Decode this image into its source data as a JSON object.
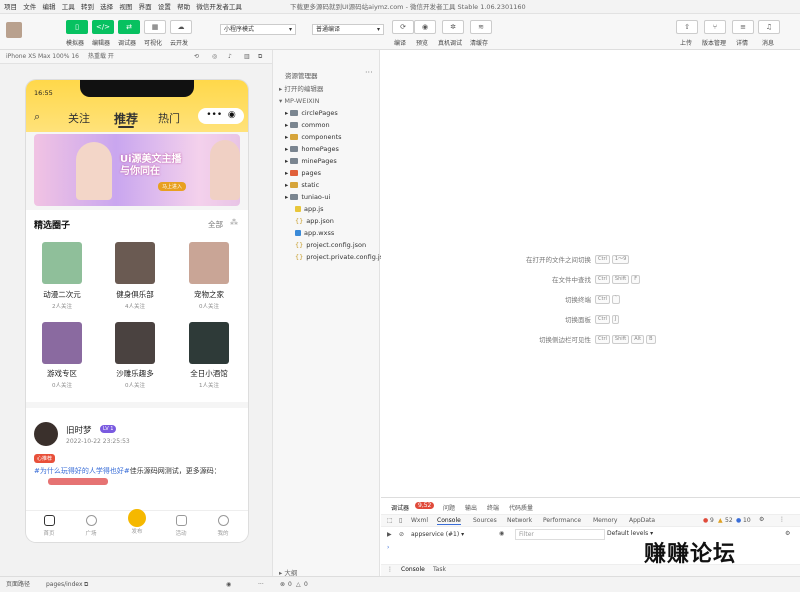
{
  "menu": {
    "items": [
      "项目",
      "文件",
      "编辑",
      "工具",
      "转到",
      "选择",
      "视图",
      "界面",
      "设置",
      "帮助",
      "微信开发者工具"
    ],
    "center_title": "下载更多源码就到UI源码站aiymz.com - 微信开发者工具 Stable 1.06.2301160"
  },
  "toolbar": {
    "buttons": [
      "模拟器",
      "编辑器",
      "调试器",
      "可视化",
      "云开发"
    ],
    "mode_select": "小程序模式",
    "compile_select": "普通编译",
    "actions": [
      "编译",
      "预览",
      "真机调试",
      "清缓存"
    ],
    "right_actions": [
      "上传",
      "版本管理",
      "详情",
      "消息"
    ]
  },
  "simulator": {
    "device": "iPhone XS Max 100% 16",
    "hot_reload": "热重载 开",
    "time": "16:55",
    "tabs": [
      "关注",
      "推荐",
      "热门"
    ],
    "banner_text": "Ui源美文主播 与你同在",
    "banner_btn": "马上进入",
    "circle_title": "精选圈子",
    "circle_all": "全部",
    "circles": [
      {
        "name": "动漫二次元",
        "count": "2人关注",
        "color": "#8fbf9a"
      },
      {
        "name": "健身俱乐部",
        "count": "4人关注",
        "color": "#6a5a52"
      },
      {
        "name": "宠物之家",
        "count": "0人关注",
        "color": "#c9a596"
      },
      {
        "name": "游戏专区",
        "count": "0人关注",
        "color": "#8a6aa0"
      },
      {
        "name": "沙雕乐趣多",
        "count": "0人关注",
        "color": "#4a4240"
      },
      {
        "name": "全日小酒馆",
        "count": "1人关注",
        "color": "#2e3a38"
      }
    ],
    "post": {
      "author": "旧时梦",
      "level": "LV 1",
      "time": "2022-10-22 23:25:53",
      "tag": "心推荐",
      "topic": "#为什么玩得好的人学得也好#",
      "content": "佳乐源码网测试，更多源码："
    },
    "tabbar": [
      "首页",
      "广场",
      "发布",
      "活动",
      "我的"
    ]
  },
  "explorer": {
    "title": "资源管理器",
    "opened": "打开的编辑器",
    "project": "MP-WEIXIN",
    "folders": [
      "circlePages",
      "common",
      "components",
      "homePages",
      "minePages",
      "pages",
      "static",
      "tuniao-ui"
    ],
    "files": [
      "app.js",
      "app.json",
      "app.wxss",
      "project.config.json",
      "project.private.config.js..."
    ]
  },
  "hints": [
    {
      "label": "在打开的文件之间切换",
      "keys": [
        "Ctrl",
        "1～9"
      ]
    },
    {
      "label": "在文件中查找",
      "keys": [
        "Ctrl",
        "Shift",
        "F"
      ]
    },
    {
      "label": "切换终端",
      "keys": [
        "Ctrl",
        "`"
      ]
    },
    {
      "label": "切换面板",
      "keys": [
        "Ctrl",
        "J"
      ]
    },
    {
      "label": "切换侧边栏可见性",
      "keys": [
        "Ctrl",
        "Shift",
        "Alt",
        "B"
      ]
    }
  ],
  "devtools": {
    "label": "调试器",
    "badge": "9,52",
    "top_tabs": [
      "问题",
      "输出",
      "终端",
      "代码质量"
    ],
    "tabs": [
      "Wxml",
      "Console",
      "Sources",
      "Network",
      "Performance",
      "Memory",
      "AppData"
    ],
    "counts": {
      "errors": "9",
      "warnings": "52",
      "info": "10"
    },
    "context": "appservice (#1)",
    "filter_placeholder": "Filter",
    "levels": "Default levels",
    "bottom_tabs": [
      "Console",
      "Task"
    ]
  },
  "status": {
    "path_label": "页面路径",
    "path": "pages/index",
    "outline": "大纲",
    "errors": "0",
    "warnings": "0"
  },
  "watermark": "赚赚论坛"
}
